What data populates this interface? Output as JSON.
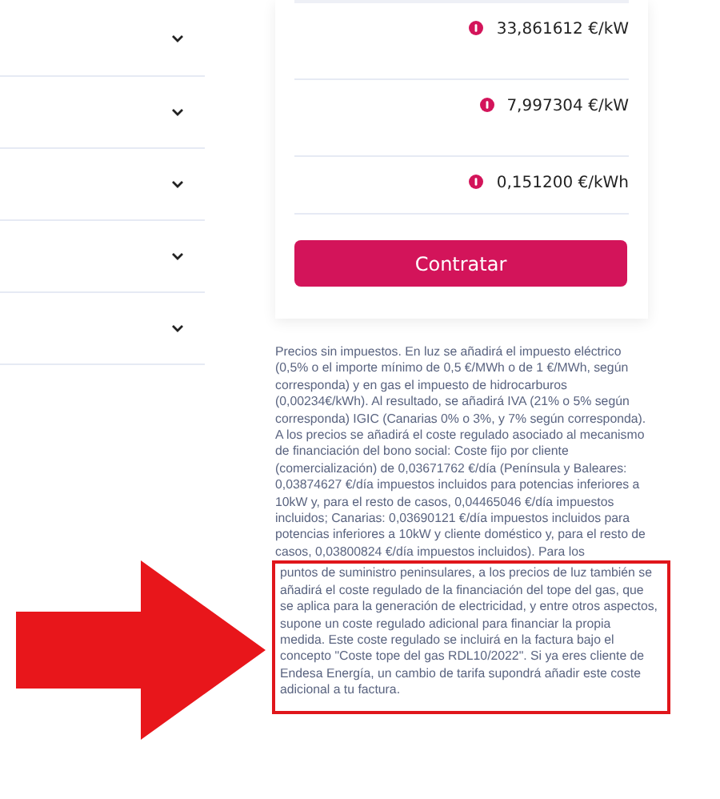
{
  "accordion": [
    {
      "expanded": false
    },
    {
      "expanded": false
    },
    {
      "expanded": false
    },
    {
      "expanded": false
    },
    {
      "expanded": false
    }
  ],
  "prices": [
    {
      "value": "33,861612 €/kW"
    },
    {
      "value": "7,997304 €/kW"
    },
    {
      "value": "0,151200 €/kWh"
    }
  ],
  "button": "Contratar",
  "disclaimer": "Precios sin impuestos. En luz se añadirá el impuesto eléctrico (0,5% o el importe mínimo de 0,5 €/MWh o de 1 €/MWh, según corresponda) y en gas el impuesto de hidrocarburos (0,00234€/kWh). Al resultado, se añadirá IVA (21% o 5% según corresponda) IGIC (Canarias 0% o 3%, y 7% según corresponda). A los precios se añadirá el coste regulado asociado al mecanismo de financiación del bono social: Coste fijo por cliente (comercialización) de 0,03671762 €/día (Península y Baleares: 0,03874627 €/día impuestos incluidos para potencias inferiores a 10kW y, para el resto de casos, 0,04465046 €/día impuestos incluidos; Canarias: 0,03690121 €/día impuestos incluidos para potencias inferiores a 10kW y cliente doméstico y, para el resto de casos, 0,03800824 €/día impuestos incluidos). Para los",
  "highlighted_note": "puntos de suministro peninsulares, a los precios de luz también se añadirá el coste regulado de la financiación del tope del gas, que se aplica para la generación de electricidad, y entre otros aspectos, supone un coste regulado adicional para financiar la propia medida. Este coste regulado se incluirá en la factura bajo el concepto \"Coste tope del gas RDL10/2022\". Si ya eres cliente de Endesa Energía, un cambio de tarifa supondrá añadir este coste adicional a tu factura."
}
